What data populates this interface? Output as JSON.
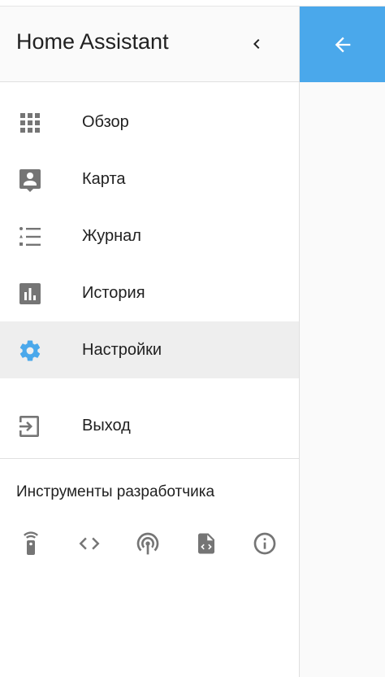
{
  "colors": {
    "accent": "#4aa8eb",
    "icon": "#757575",
    "active_icon": "#4aa8eb",
    "active_bg": "#eeeeee",
    "text": "#212121"
  },
  "sidebar": {
    "title": "Home Assistant",
    "collapse_icon": "chevron-left-icon",
    "items": [
      {
        "label": "Обзор",
        "icon": "apps-grid-icon"
      },
      {
        "label": "Карта",
        "icon": "account-location-icon"
      },
      {
        "label": "Журнал",
        "icon": "format-list-bulleted-icon"
      },
      {
        "label": "История",
        "icon": "bar-chart-icon"
      },
      {
        "label": "Настройки",
        "icon": "settings-icon",
        "active": true
      },
      {
        "label": "Выход",
        "icon": "exit-to-app-icon"
      }
    ]
  },
  "developer_tools": {
    "title": "Инструменты разработчика",
    "icons": [
      "remote-icon",
      "code-tags-icon",
      "radio-tower-icon",
      "file-code-icon",
      "information-icon"
    ]
  },
  "right_panel": {
    "back_icon": "arrow-left-icon"
  }
}
